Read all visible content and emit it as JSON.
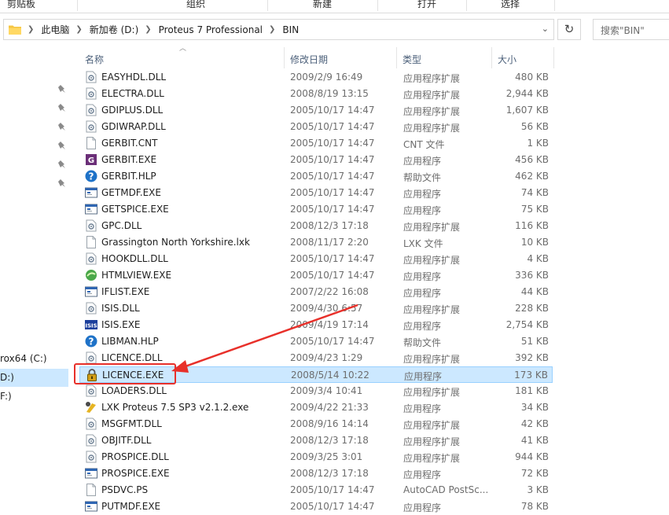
{
  "ribbon": {
    "groups": [
      "剪贴板",
      "组织",
      "新建",
      "打开",
      "选择"
    ]
  },
  "address": {
    "crumbs": [
      "此电脑",
      "新加卷 (D:)",
      "Proteus 7 Professional",
      "BIN"
    ],
    "search_placeholder": "搜索\"BIN\""
  },
  "nav": {
    "drives": [
      {
        "label": "rox64 (C:)",
        "selected": false
      },
      {
        "label": "D:)",
        "selected": true
      },
      {
        "label": "F:)",
        "selected": false
      }
    ]
  },
  "columns": {
    "name": "名称",
    "date": "修改日期",
    "type": "类型",
    "size": "大小"
  },
  "files": [
    {
      "name": "EASYHDL.DLL",
      "date": "2009/2/9 16:49",
      "type": "应用程序扩展",
      "size": "480 KB",
      "icon": "dll-icon"
    },
    {
      "name": "ELECTRA.DLL",
      "date": "2008/8/19 13:15",
      "type": "应用程序扩展",
      "size": "2,944 KB",
      "icon": "dll-icon"
    },
    {
      "name": "GDIPLUS.DLL",
      "date": "2005/10/17 14:47",
      "type": "应用程序扩展",
      "size": "1,607 KB",
      "icon": "dll-icon"
    },
    {
      "name": "GDIWRAP.DLL",
      "date": "2005/10/17 14:47",
      "type": "应用程序扩展",
      "size": "56 KB",
      "icon": "dll-icon"
    },
    {
      "name": "GERBIT.CNT",
      "date": "2005/10/17 14:47",
      "type": "CNT 文件",
      "size": "1 KB",
      "icon": "file-icon"
    },
    {
      "name": "GERBIT.EXE",
      "date": "2005/10/17 14:47",
      "type": "应用程序",
      "size": "456 KB",
      "icon": "gerbit-app-icon"
    },
    {
      "name": "GERBIT.HLP",
      "date": "2005/10/17 14:47",
      "type": "帮助文件",
      "size": "462 KB",
      "icon": "help-icon"
    },
    {
      "name": "GETMDF.EXE",
      "date": "2005/10/17 14:47",
      "type": "应用程序",
      "size": "74 KB",
      "icon": "exe-icon"
    },
    {
      "name": "GETSPICE.EXE",
      "date": "2005/10/17 14:47",
      "type": "应用程序",
      "size": "75 KB",
      "icon": "exe-icon"
    },
    {
      "name": "GPC.DLL",
      "date": "2008/12/3 17:18",
      "type": "应用程序扩展",
      "size": "116 KB",
      "icon": "dll-icon"
    },
    {
      "name": "Grassington North Yorkshire.lxk",
      "date": "2008/11/17 2:20",
      "type": "LXK 文件",
      "size": "10 KB",
      "icon": "file-icon"
    },
    {
      "name": "HOOKDLL.DLL",
      "date": "2005/10/17 14:47",
      "type": "应用程序扩展",
      "size": "4 KB",
      "icon": "dll-icon"
    },
    {
      "name": "HTMLVIEW.EXE",
      "date": "2005/10/17 14:47",
      "type": "应用程序",
      "size": "336 KB",
      "icon": "htmlview-icon"
    },
    {
      "name": "IFLIST.EXE",
      "date": "2007/2/22 16:08",
      "type": "应用程序",
      "size": "44 KB",
      "icon": "exe-icon"
    },
    {
      "name": "ISIS.DLL",
      "date": "2009/4/30 6:57",
      "type": "应用程序扩展",
      "size": "228 KB",
      "icon": "dll-icon"
    },
    {
      "name": "ISIS.EXE",
      "date": "2009/4/19 17:14",
      "type": "应用程序",
      "size": "2,754 KB",
      "icon": "isis-app-icon"
    },
    {
      "name": "LIBMAN.HLP",
      "date": "2005/10/17 14:47",
      "type": "帮助文件",
      "size": "51 KB",
      "icon": "help-icon"
    },
    {
      "name": "LICENCE.DLL",
      "date": "2009/4/23 1:29",
      "type": "应用程序扩展",
      "size": "392 KB",
      "icon": "dll-icon"
    },
    {
      "name": "LICENCE.EXE",
      "date": "2008/5/14 10:22",
      "type": "应用程序",
      "size": "173 KB",
      "icon": "lock-icon",
      "selected": true
    },
    {
      "name": "LOADERS.DLL",
      "date": "2009/3/4 10:41",
      "type": "应用程序扩展",
      "size": "181 KB",
      "icon": "dll-icon"
    },
    {
      "name": "LXK Proteus 7.5 SP3 v2.1.2.exe",
      "date": "2009/4/22 21:33",
      "type": "应用程序",
      "size": "34 KB",
      "icon": "lxk-app-icon"
    },
    {
      "name": "MSGFMT.DLL",
      "date": "2008/9/16 14:14",
      "type": "应用程序扩展",
      "size": "42 KB",
      "icon": "dll-icon"
    },
    {
      "name": "OBJITF.DLL",
      "date": "2008/12/3 17:18",
      "type": "应用程序扩展",
      "size": "41 KB",
      "icon": "dll-icon"
    },
    {
      "name": "PROSPICE.DLL",
      "date": "2009/3/25 3:01",
      "type": "应用程序扩展",
      "size": "944 KB",
      "icon": "dll-icon"
    },
    {
      "name": "PROSPICE.EXE",
      "date": "2008/12/3 17:18",
      "type": "应用程序",
      "size": "72 KB",
      "icon": "exe-icon"
    },
    {
      "name": "PSDVC.PS",
      "date": "2005/10/17 14:47",
      "type": "AutoCAD PostSc...",
      "size": "3 KB",
      "icon": "file-icon"
    },
    {
      "name": "PUTMDF.EXE",
      "date": "2005/10/17 14:47",
      "type": "应用程序",
      "size": "78 KB",
      "icon": "exe-icon"
    }
  ],
  "colors": {
    "selection": "#cce8ff",
    "selection_border": "#99d1ff",
    "annotation": "#e8302a"
  }
}
